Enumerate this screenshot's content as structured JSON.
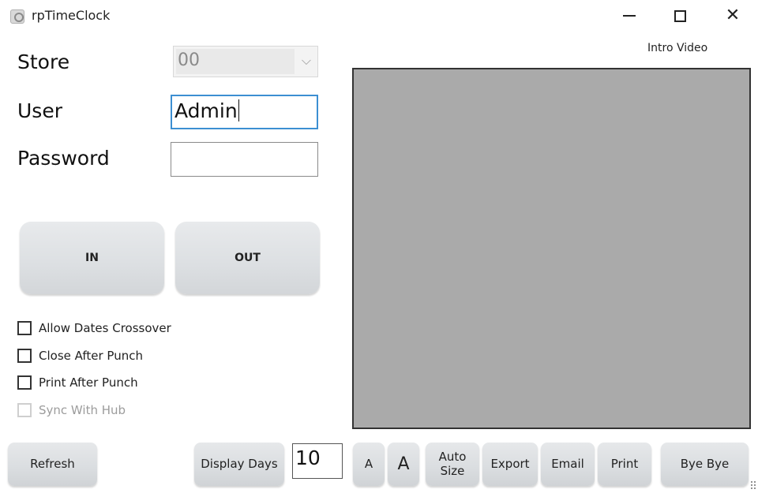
{
  "window": {
    "title": "rpTimeClock",
    "app_icon": "clock-app-icon",
    "controls": {
      "minimize_icon": "minimize-icon",
      "maximize_icon": "maximize-icon",
      "close_icon": "close-icon",
      "close_glyph": "✕"
    }
  },
  "form": {
    "store_label": "Store",
    "store_value": "00",
    "store_chevron": "⌵",
    "user_label": "User",
    "user_value": "Admin",
    "password_label": "Password",
    "password_value": ""
  },
  "punch": {
    "in_label": "IN",
    "out_label": "OUT"
  },
  "options": [
    {
      "label": "Allow Dates Crossover",
      "checked": false,
      "enabled": true
    },
    {
      "label": "Close After Punch",
      "checked": false,
      "enabled": true
    },
    {
      "label": "Print After Punch",
      "checked": false,
      "enabled": true
    },
    {
      "label": "Sync With Hub",
      "checked": false,
      "enabled": false
    }
  ],
  "video": {
    "label": "Intro Video"
  },
  "toolbar": {
    "refresh_label": "Refresh",
    "display_days_label": "Display Days",
    "display_days_value": "10",
    "font_smaller_label": "A",
    "font_larger_label": "A",
    "auto_size_label": "Auto Size",
    "export_label": "Export",
    "email_label": "Email",
    "print_label": "Print",
    "bye_label": "Bye Bye"
  }
}
